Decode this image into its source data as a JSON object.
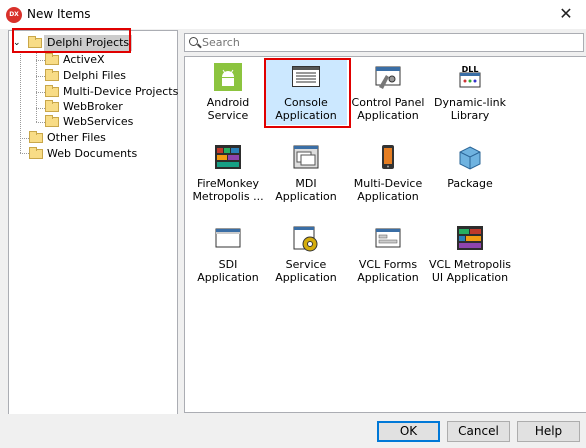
{
  "window": {
    "title": "New Items",
    "app_icon_text": "DX"
  },
  "tree": {
    "root": "Delphi Projects",
    "children": [
      "ActiveX",
      "Delphi Files",
      "Multi-Device Projects",
      "WebBroker",
      "WebServices"
    ],
    "siblings": [
      "Other Files",
      "Web Documents"
    ]
  },
  "search": {
    "placeholder": "Search",
    "value": ""
  },
  "items": [
    {
      "label1": "Android Service",
      "label2": "",
      "icon": "android-icon"
    },
    {
      "label1": "Console",
      "label2": "Application",
      "icon": "console-icon"
    },
    {
      "label1": "Control Panel",
      "label2": "Application",
      "icon": "control-panel-icon"
    },
    {
      "label1": "Dynamic-link",
      "label2": "Library",
      "icon": "dll-icon"
    },
    {
      "label1": "FireMonkey",
      "label2": "Metropolis ...",
      "icon": "firemonkey-icon"
    },
    {
      "label1": "MDI Application",
      "label2": "",
      "icon": "mdi-icon"
    },
    {
      "label1": "Multi-Device",
      "label2": "Application",
      "icon": "multi-device-icon"
    },
    {
      "label1": "Package",
      "label2": "",
      "icon": "package-icon"
    },
    {
      "label1": "SDI Application",
      "label2": "",
      "icon": "sdi-icon"
    },
    {
      "label1": "Service",
      "label2": "Application",
      "icon": "service-icon"
    },
    {
      "label1": "VCL Forms",
      "label2": "Application",
      "icon": "vcl-forms-icon"
    },
    {
      "label1": "VCL Metropolis",
      "label2": "UI Application",
      "icon": "vcl-metropolis-icon"
    }
  ],
  "buttons": {
    "ok": "OK",
    "cancel": "Cancel",
    "help": "Help"
  },
  "colors": {
    "highlight_red": "#e00000",
    "selection_bg": "#cce8ff",
    "default_button": "#0078d7"
  }
}
